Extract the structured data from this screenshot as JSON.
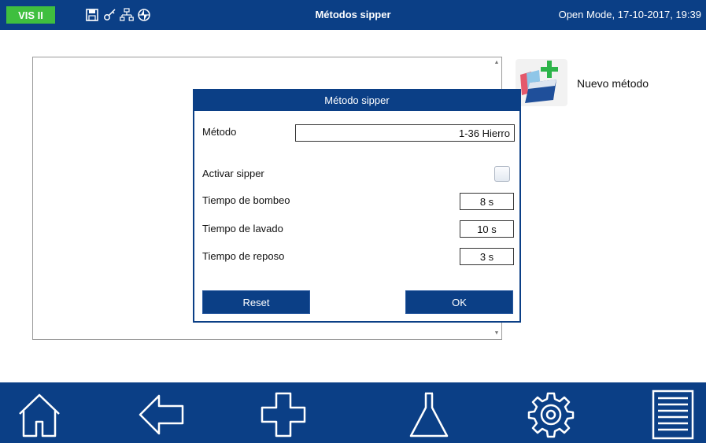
{
  "header": {
    "badge": "VIS II",
    "title": "Métodos sipper",
    "status": "Open Mode, 17-10-2017, 19:39",
    "tool_icons": [
      "save-icon",
      "key-icon",
      "network-icon",
      "globe-icon"
    ]
  },
  "new_method": {
    "label": "Nuevo método",
    "icon": "new-method-icon"
  },
  "dialog": {
    "title": "Método sipper",
    "method_label": "Método",
    "method_value": "1-36 Hierro",
    "sipper_label": "Activar sipper",
    "sipper_checked": false,
    "pump_label": "Tiempo de bombeo",
    "pump_value": "8 s",
    "wash_label": "Tiempo de lavado",
    "wash_value": "10 s",
    "rest_label": "Tiempo de reposo",
    "rest_value": "3 s",
    "reset_label": "Reset",
    "ok_label": "OK"
  },
  "nav": [
    "home-icon",
    "back-arrow-icon",
    "add-icon",
    "flask-icon",
    "settings-gear-icon",
    "menu-list-icon"
  ],
  "colors": {
    "primary": "#0b3f86",
    "badge": "#3fbf3f",
    "background": "#ffffff"
  }
}
